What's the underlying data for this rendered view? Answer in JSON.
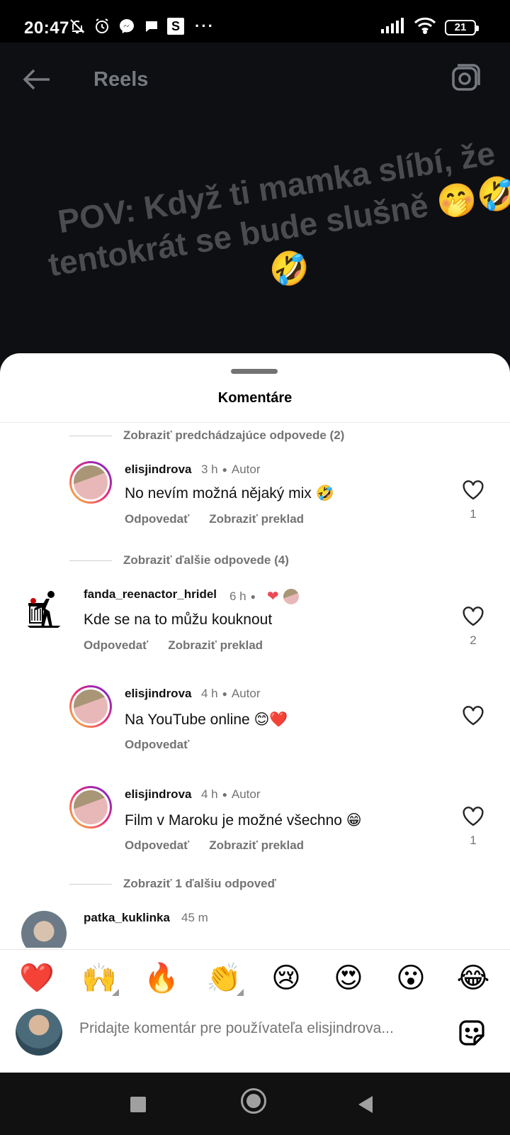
{
  "status_bar": {
    "time": "20:47",
    "battery": "21",
    "more": "···",
    "s_badge": "S"
  },
  "reel": {
    "title": "Reels",
    "overlay_text": "POV: Když ti mamka slíbí, že tentokrát se bude slušně 🤭🤣🤣"
  },
  "sheet": {
    "title": "Komentáre"
  },
  "comments": {
    "show_previous": "Zobraziť predchádzajúce odpovede (2)",
    "c1": {
      "username": "elisjindrova",
      "time": "3 h",
      "badge": "Autor",
      "text": "No nevím možná nějaký mix 🤣",
      "reply": "Odpovedať",
      "translate": "Zobraziť preklad",
      "likes": "1"
    },
    "show_more_4": "Zobraziť ďalšie odpovede (4)",
    "c2": {
      "username": "fanda_reenactor_hridel",
      "time": "6 h",
      "text": "Kde se na to můžu kouknout",
      "reply": "Odpovedať",
      "translate": "Zobraziť preklad",
      "likes": "2"
    },
    "c3": {
      "username": "elisjindrova",
      "time": "4 h",
      "badge": "Autor",
      "text": "Na YouTube online 😊❤️",
      "reply": "Odpovedať"
    },
    "c4": {
      "username": "elisjindrova",
      "time": "4 h",
      "badge": "Autor",
      "text": "Film v Maroku je možné všechno 😁",
      "reply": "Odpovedať",
      "translate": "Zobraziť preklad",
      "likes": "1"
    },
    "show_more_1": "Zobraziť 1 ďalšiu odpoveď",
    "c5": {
      "username": "patka_kuklinka",
      "time": "45 m"
    }
  },
  "reactions": [
    "❤️",
    "🙌",
    "🔥",
    "👏",
    "😢",
    "😍",
    "😮",
    "😂"
  ],
  "input": {
    "placeholder": "Pridajte komentár pre používateľa elisjindrova..."
  },
  "colors": {
    "secondary_text": "#737373",
    "like_heart": "#ed4956"
  }
}
